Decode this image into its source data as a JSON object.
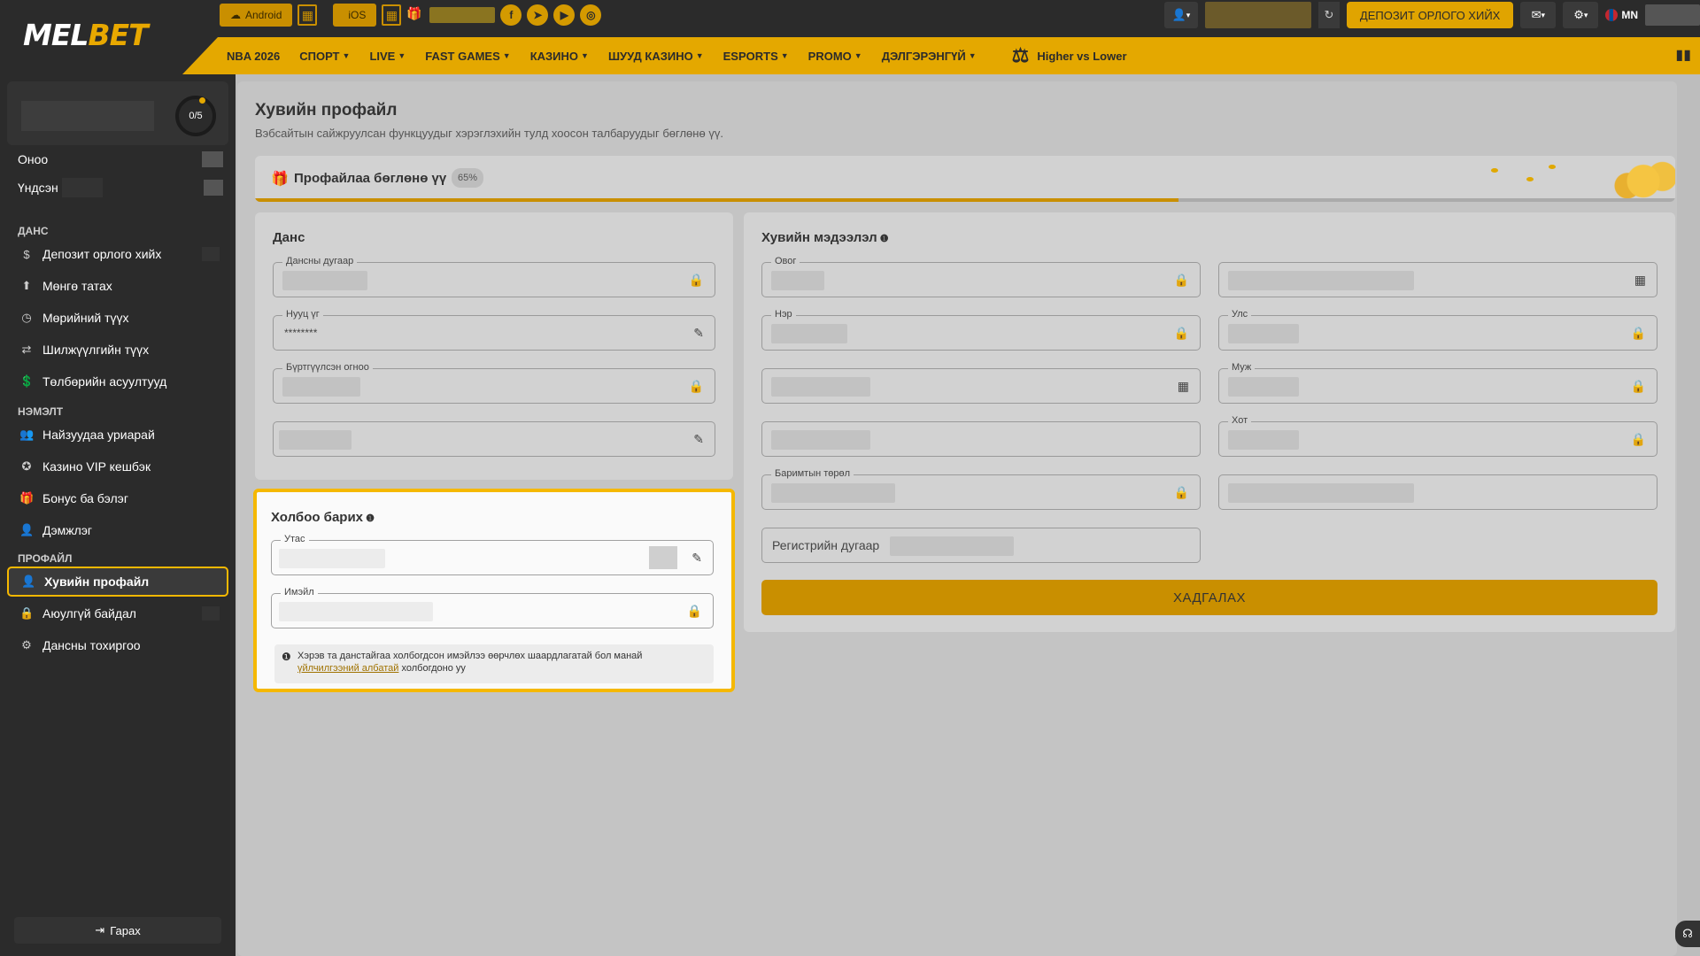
{
  "header": {
    "logo_part1": "MEL",
    "logo_part2": "BET",
    "android_label": "Android",
    "ios_label": "iOS",
    "deposit_button": "ДЕПОЗИТ ОРЛОГО ХИЙХ",
    "lang": "MN"
  },
  "nav": {
    "items": [
      "NBA 2026",
      "СПОРТ",
      "LIVE",
      "FAST GAMES",
      "КАЗИНО",
      "ШУУД КАЗИНО",
      "ESPORTS",
      "PROMO",
      "ДЭЛГЭРЭНГҮЙ"
    ],
    "special": "Higher vs Lower"
  },
  "sidebar": {
    "ring": "0/5",
    "points_label": "Оноо",
    "main_label": "Үндсэн",
    "section_account": "ДАНС",
    "section_extra": "НЭМЭЛТ",
    "section_profile": "ПРОФАЙЛ",
    "items": [
      "Депозит орлого хийх",
      "Мөнгө татах",
      "Мөрийний түүх",
      "Шилжүүлгийн түүх",
      "Төлбөрийн асуултууд",
      "Найзуудаа уриарай",
      "Казино VIP кешбэк",
      "Бонус ба бэлэг",
      "Дэмжлэг",
      "Хувийн профайл",
      "Аюулгүй байдал",
      "Дансны тохиргоо"
    ],
    "logout": "Гарах"
  },
  "page": {
    "title": "Хувийн профайл",
    "subtitle": "Вэбсайтын сайжруулсан функцуудыг хэрэглэхийн тулд хоосон талбаруудыг бөглөнө үү.",
    "progress_label": "Профайлаа бөглөнө үү",
    "progress_badge": "65%",
    "progress_value": 0.65
  },
  "account": {
    "title": "Данс",
    "account_number_label": "Дансны дугаар",
    "password_label": "Нууц үг",
    "password_value": "********",
    "registered_label": "Бүртгүүлсэн огноо"
  },
  "contact": {
    "title": "Холбоо барих",
    "phone_label": "Утас",
    "email_label": "Имэйл",
    "notice_text": "Хэрэв та данстайгаа холбогдсон имэйлээ өөрчлөх шаардлагатай бол манай",
    "notice_link": "үйлчилгээний албатай",
    "notice_end": "холбогдоно уу"
  },
  "personal": {
    "title": "Хувийн мэдээлэл",
    "surname_label": "Овог",
    "name_label": "Нэр",
    "country_label": "Улс",
    "province_label": "Муж",
    "city_label": "Хот",
    "doc_type_label": "Баримтын төрөл",
    "reg_number_label": "Регистрийн дугаар",
    "save_button": "ХАДГАЛАХ"
  }
}
